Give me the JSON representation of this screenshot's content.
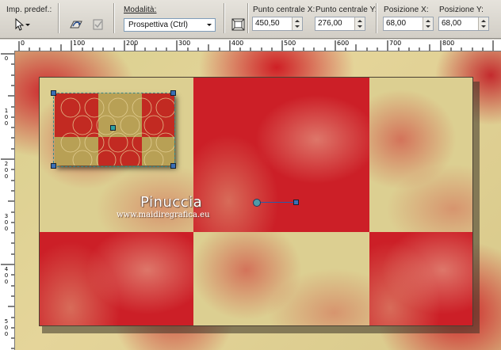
{
  "toolbar": {
    "presets_label": "Imp. predef.:",
    "mode_label": "Modalità:",
    "mode_value": "Prospettiva (Ctrl)",
    "center_x_label": "Punto centrale X:",
    "center_x_value": "450,50",
    "center_y_label": "Punto centrale Y:",
    "center_y_value": "276,00",
    "pos_x_label": "Posizione X:",
    "pos_x_value": "68,00",
    "pos_y_label": "Posizione Y:",
    "pos_y_value": "68,00"
  },
  "ruler_top": [
    "0",
    "100",
    "200",
    "300",
    "400",
    "500",
    "600",
    "700",
    "800"
  ],
  "ruler_left": [
    "0",
    "100",
    "200",
    "300",
    "400",
    "500"
  ],
  "watermark": {
    "name": "Pinuccia",
    "site": "www.maidiregrafica.eu"
  },
  "icons": {
    "pick": "arrow-pointer-icon",
    "reset": "reset-icon",
    "apply": "apply-icon",
    "fit": "fit-canvas-icon"
  },
  "colors": {
    "red": "#cc1f27",
    "yellow": "#dccf91",
    "selection": "#3b6fb6"
  }
}
